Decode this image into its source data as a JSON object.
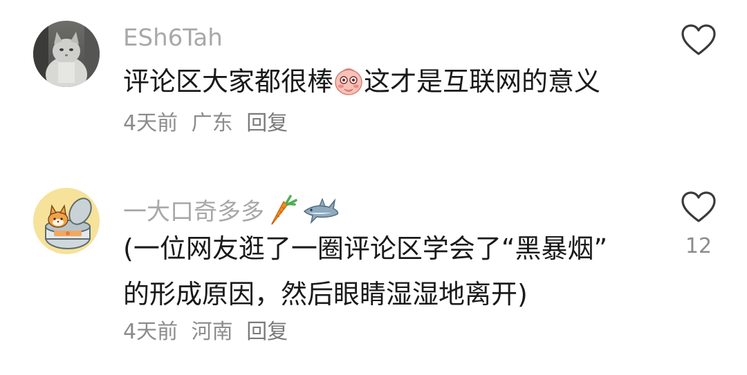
{
  "comments": [
    {
      "username": "ESh6Tah",
      "text_before": "评论区大家都很棒",
      "text_after": "这才是互联网的意义",
      "text_emoji": "blushing-face-emoji",
      "time": "4天前",
      "location": "广东",
      "reply_label": "回复",
      "like_count": "",
      "avatar": "cat-photo-avatar"
    },
    {
      "username": "一大口奇多多",
      "name_emojis": [
        "carrot-emoji",
        "shark-emoji"
      ],
      "text_line1": "(一位网友逛了一圈评论区学会了“黑暴烟”",
      "text_line2": "的形成原因，然后眼睛湿湿地离开)",
      "time": "4天前",
      "location": "河南",
      "reply_label": "回复",
      "like_count": "12",
      "avatar": "cartoon-fox-can-avatar"
    }
  ],
  "colors": {
    "username": "#a8a8a8",
    "text": "#1a1a1a",
    "meta": "#8c8c8c",
    "avatar2_bg": "#f6e29a"
  }
}
